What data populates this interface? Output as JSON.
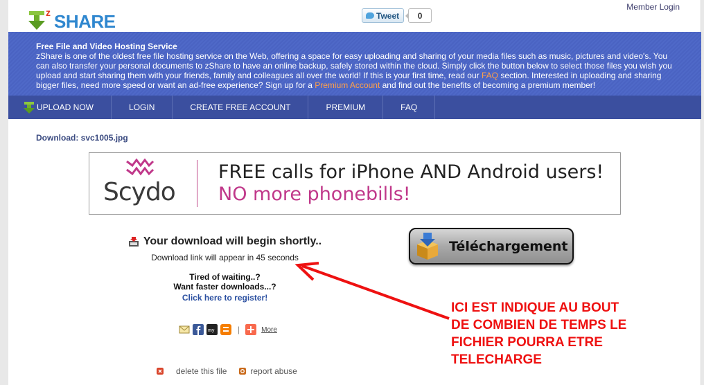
{
  "header": {
    "logo_text": "SHARE",
    "logo_z": "z",
    "tweet_label": "Tweet",
    "tweet_count": "0",
    "member_login": "Member Login"
  },
  "intro": {
    "title": "Free File and Video Hosting Service",
    "text_1": "zShare is one of the oldest free file hosting service on the Web, offering a space for easy uploading and sharing of your media files such as music, pictures and video's. You can also transfer your personal documents to zShare to have an online backup, safely stored within the cloud. Simply click the button below to select those files you wish you upload and start sharing them with your friends, family and colleagues all over the world! If this is your first time, read our ",
    "faq_link": "FAQ",
    "text_2": " section. Interested in uploading and sharing bigger files, need more speed or want an ad-free experience? Sign up for a ",
    "premium_link": "Premium Account",
    "text_3": " and find out the benefits of becoming a premium member!"
  },
  "nav": {
    "items": [
      "UPLOAD NOW",
      "LOGIN",
      "CREATE FREE ACCOUNT",
      "PREMIUM",
      "FAQ"
    ]
  },
  "download": {
    "title": "Download: svc1005.jpg",
    "headline": "Your download will begin shortly..",
    "countdown_text": "Download link will appear in 45 seconds",
    "tired": "Tired of waiting..?",
    "faster": "Want faster downloads...?",
    "register": "Click here to register!",
    "button_label": "Téléchargement"
  },
  "ad": {
    "brand": "Scydo",
    "line1": "FREE calls for iPhone AND Android users!",
    "line2": "NO more phonebills!"
  },
  "share": {
    "more": "More"
  },
  "footer": {
    "delete": "delete this file",
    "report": "report abuse"
  },
  "annotation": {
    "lines": [
      "ICI EST INDIQUE AU BOUT",
      "DE COMBIEN DE TEMPS LE",
      "FICHIER POURRA ETRE",
      "TELECHARGE"
    ],
    "color": "#ee1111"
  },
  "colors": {
    "intro_bg": "#4a63c2",
    "nav_bg": "#3b4f9f",
    "link_orange": "#ffa04a",
    "register_blue": "#2a4fa0"
  }
}
